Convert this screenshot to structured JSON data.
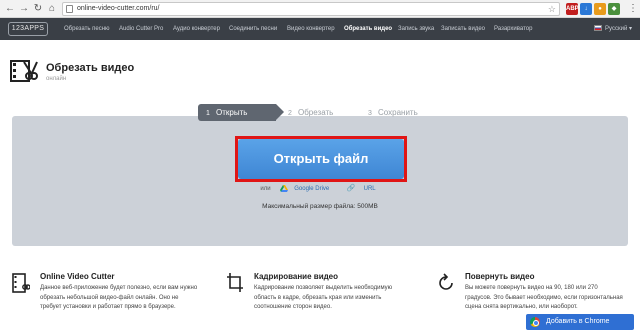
{
  "browser": {
    "url": "online-video-cutter.com/ru/",
    "extensions": [
      {
        "label": "ABP",
        "color": "#c11e1e"
      },
      {
        "label": "↓",
        "color": "#2b78d6"
      },
      {
        "label": "●",
        "color": "#e89b1c"
      },
      {
        "label": "◆",
        "color": "#4a8f3c"
      }
    ]
  },
  "nav": {
    "logo": "123APPS",
    "items": [
      "Обрезать песню",
      "Audio Cutter Pro",
      "Аудио конвертер",
      "Соединить песни",
      "Видео конвертер",
      "Обрезать видео",
      "Запись звука",
      "Записать видео",
      "Разархиватор"
    ],
    "active_index": 5,
    "language": "Русский"
  },
  "app": {
    "title": "Обрезать видео",
    "subtitle": "онлайн"
  },
  "steps": [
    {
      "num": "1",
      "label": "Открыть"
    },
    {
      "num": "2",
      "label": "Обрезать"
    },
    {
      "num": "3",
      "label": "Сохранить"
    }
  ],
  "upload": {
    "open_button": "Открыть файл",
    "or_label": "или",
    "google_drive": "Google Drive",
    "url": "URL",
    "max_size": "Максимальный размер файла: 500MB"
  },
  "features": [
    {
      "title": "Online Video Cutter",
      "text": "Данное веб-приложение будет полезно, если вам нужно обрезать небольшой видео-файл онлайн. Оно не требует установки и работает прямо в браузере."
    },
    {
      "title": "Кадрирование видео",
      "text": "Кадрирование позволяет выделить необходимую область в кадре, обрезать края или изменить соотношение сторон видео."
    },
    {
      "title": "Повернуть видео",
      "text": "Вы можете повернуть видео на 90, 180 или 270 градусов. Это бывает необходимо, если горизонтальная сцена снята вертикально, или наоборот."
    }
  ],
  "chrome_badge": "Добавить в Chrome"
}
